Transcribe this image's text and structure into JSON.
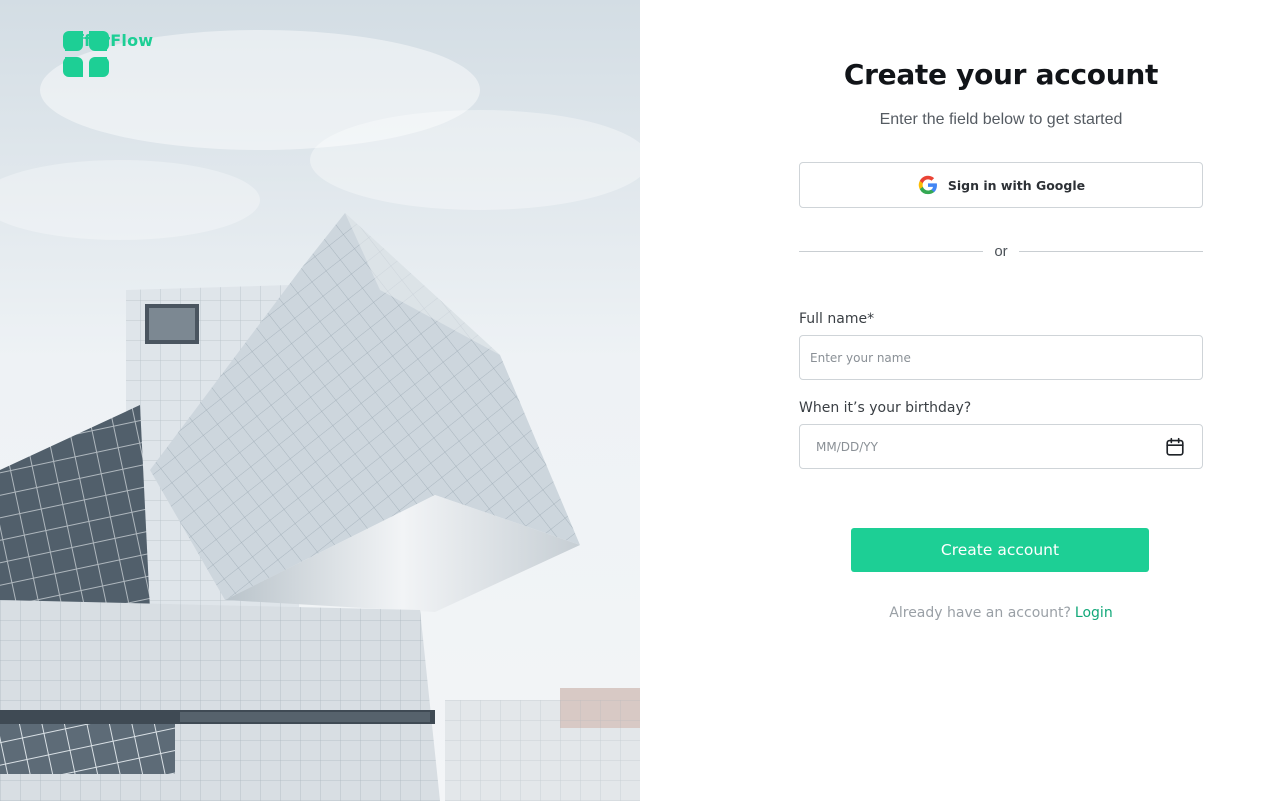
{
  "brand": {
    "name": "OfferFlow",
    "color": "#1dcf95"
  },
  "hero": {
    "image": "modern-building-photo"
  },
  "form": {
    "title": "Create your account",
    "subtitle": "Enter the field below to get started",
    "google_button": "Sign in with Google",
    "divider": "or",
    "full_name": {
      "label": "Full name*",
      "placeholder": "Enter your name",
      "value": ""
    },
    "birthday": {
      "label": "When it’s your birthday?",
      "placeholder": "MM/DD/YY",
      "value": ""
    },
    "submit": "Create account",
    "login_prompt": "Already have an account?",
    "login_link": "Login"
  },
  "colors": {
    "accent": "#1dcf95",
    "link": "#12a879",
    "text": "#111418"
  },
  "icons": [
    "offerflow-logo-icon",
    "google-icon",
    "calendar-icon"
  ]
}
